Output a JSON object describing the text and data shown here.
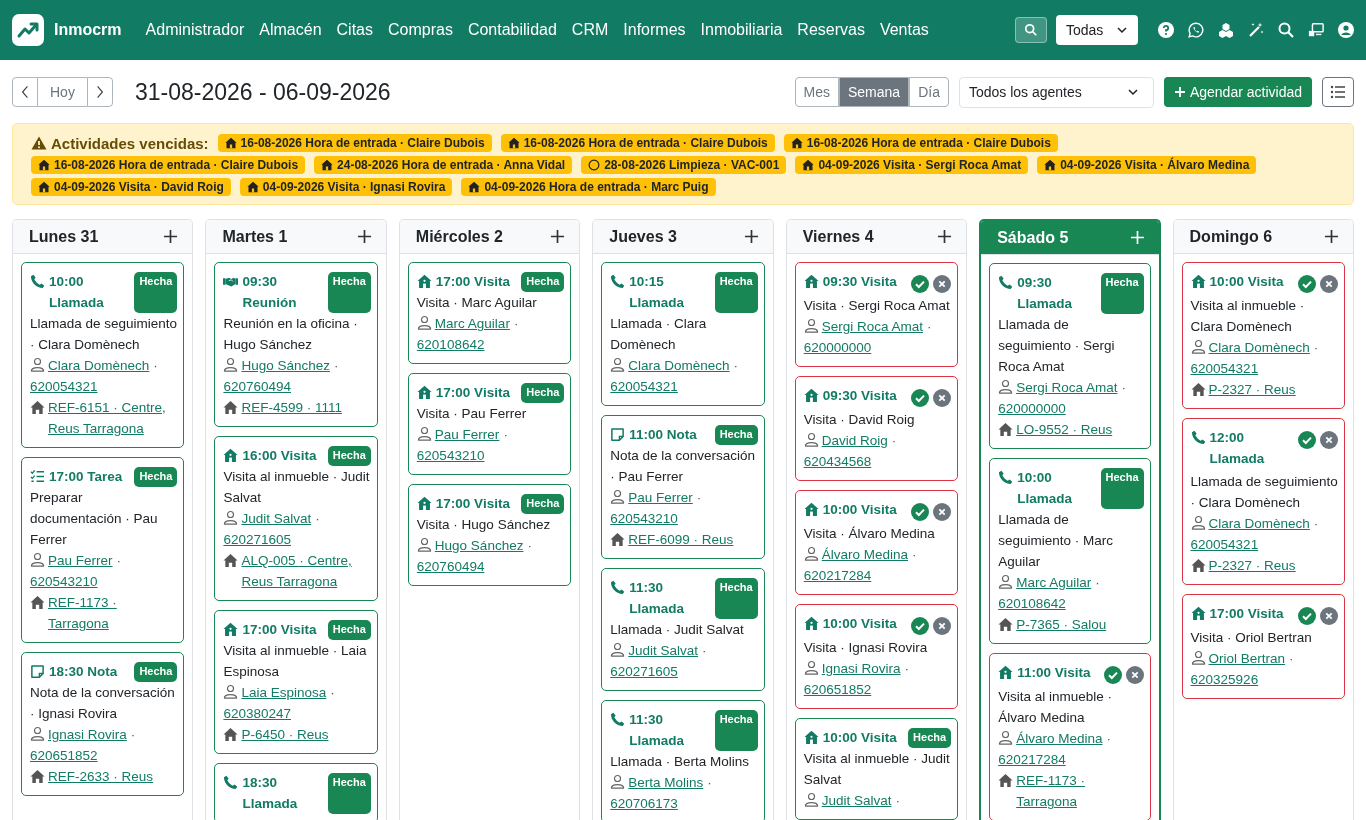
{
  "brand": "Inmocrm",
  "nav": [
    "Administrador",
    "Almacén",
    "Citas",
    "Compras",
    "Contabilidad",
    "CRM",
    "Informes",
    "Inmobiliaria",
    "Reservas",
    "Ventas"
  ],
  "scope_select": {
    "value": "Todas"
  },
  "toolbar": {
    "today": "Hoy",
    "range": "31-08-2026 - 06-09-2026",
    "views": [
      {
        "label": "Mes",
        "selected": false
      },
      {
        "label": "Semana",
        "selected": true
      },
      {
        "label": "Día",
        "selected": false
      }
    ],
    "agent_select": {
      "value": "Todos los agentes"
    },
    "add_button": "Agendar actividad"
  },
  "overdue": {
    "title": "Actividades vencidas:",
    "items": [
      {
        "kind": "visit",
        "text": "16-08-2026 Hora de entrada · Claire Dubois"
      },
      {
        "kind": "visit",
        "text": "16-08-2026 Hora de entrada · Claire Dubois"
      },
      {
        "kind": "visit",
        "text": "16-08-2026 Hora de entrada · Claire Dubois"
      },
      {
        "kind": "visit",
        "text": "16-08-2026 Hora de entrada · Claire Dubois"
      },
      {
        "kind": "visit",
        "text": "24-08-2026 Hora de entrada · Anna Vidal"
      },
      {
        "kind": "other",
        "text": "28-08-2026 Limpieza · VAC-001"
      },
      {
        "kind": "visit",
        "text": "04-09-2026 Visita · Sergi Roca Amat"
      },
      {
        "kind": "visit",
        "text": "04-09-2026 Visita · Álvaro Medina"
      },
      {
        "kind": "visit",
        "text": "04-09-2026 Visita · David Roig"
      },
      {
        "kind": "visit",
        "text": "04-09-2026 Visita · Ignasi Rovira"
      },
      {
        "kind": "visit",
        "text": "04-09-2026 Hora de entrada · Marc Puig"
      }
    ]
  },
  "separator": "·",
  "days": [
    {
      "label": "Lunes 31",
      "selected": false,
      "events": [
        {
          "kind": "call",
          "title": "10:00 Llamada",
          "done": true,
          "badge": "Hecha",
          "description": "Llamada de seguimiento · Clara Domènech",
          "contact": "Clara Domènech",
          "phone": "620054321",
          "property": "REF-6151 · Centre, Reus Tarragona"
        },
        {
          "kind": "task",
          "title": "17:00 Tarea",
          "done": true,
          "badge": "Hecha",
          "description": "Preparar documentación · Pau Ferrer",
          "contact": "Pau Ferrer",
          "phone": "620543210",
          "property": "REF-1173 · Tarragona"
        },
        {
          "kind": "note",
          "title": "18:30 Nota",
          "done": true,
          "badge": "Hecha",
          "description": "Nota de la conversación · Ignasi Rovira",
          "contact": "Ignasi Rovira",
          "phone": "620651852",
          "property": "REF-2633 · Reus"
        }
      ]
    },
    {
      "label": "Martes 1",
      "selected": false,
      "events": [
        {
          "kind": "meeting",
          "title": "09:30 Reunión",
          "done": true,
          "badge": "Hecha",
          "description": "Reunión en la oficina · Hugo Sánchez",
          "contact": "Hugo Sánchez",
          "phone": "620760494",
          "property": "REF-4599 · 1111"
        },
        {
          "kind": "visit",
          "title": "16:00 Visita",
          "done": true,
          "badge": "Hecha",
          "description": "Visita al inmueble · Judit Salvat",
          "contact": "Judit Salvat",
          "phone": "620271605",
          "property": "ALQ-005 · Centre, Reus Tarragona"
        },
        {
          "kind": "visit",
          "title": "17:00 Visita",
          "done": true,
          "badge": "Hecha",
          "description": "Visita al inmueble · Laia Espinosa",
          "contact": "Laia Espinosa",
          "phone": "620380247",
          "property": "P-6450 · Reus"
        },
        {
          "kind": "call",
          "title": "18:30 Llamada",
          "done": true,
          "badge": "Hecha"
        }
      ]
    },
    {
      "label": "Miércoles 2",
      "selected": false,
      "events": [
        {
          "kind": "visit",
          "title": "17:00 Visita",
          "done": true,
          "badge": "Hecha",
          "description": "Visita · Marc Aguilar",
          "contact": "Marc Aguilar",
          "phone": "620108642"
        },
        {
          "kind": "visit",
          "title": "17:00 Visita",
          "done": true,
          "badge": "Hecha",
          "description": "Visita · Pau Ferrer",
          "contact": "Pau Ferrer",
          "phone": "620543210"
        },
        {
          "kind": "visit",
          "title": "17:00 Visita",
          "done": true,
          "badge": "Hecha",
          "description": "Visita · Hugo Sánchez",
          "contact": "Hugo Sánchez",
          "phone": "620760494"
        }
      ]
    },
    {
      "label": "Jueves 3",
      "selected": false,
      "events": [
        {
          "kind": "call",
          "title": "10:15 Llamada",
          "done": true,
          "badge": "Hecha",
          "description": "Llamada · Clara Domènech",
          "contact": "Clara Domènech",
          "phone": "620054321"
        },
        {
          "kind": "note",
          "title": "11:00 Nota",
          "done": true,
          "badge": "Hecha",
          "description": "Nota de la conversación · Pau Ferrer",
          "contact": "Pau Ferrer",
          "phone": "620543210",
          "property": "REF-6099 · Reus"
        },
        {
          "kind": "call",
          "title": "11:30 Llamada",
          "done": true,
          "badge": "Hecha",
          "description": "Llamada · Judit Salvat",
          "contact": "Judit Salvat",
          "phone": "620271605"
        },
        {
          "kind": "call",
          "title": "11:30 Llamada",
          "done": true,
          "badge": "Hecha",
          "description": "Llamada · Berta Molins",
          "contact": "Berta Molins",
          "phone": "620706173"
        }
      ]
    },
    {
      "label": "Viernes 4",
      "selected": false,
      "events": [
        {
          "kind": "visit",
          "title": "09:30 Visita",
          "done": false,
          "description": "Visita · Sergi Roca Amat",
          "contact": "Sergi Roca Amat",
          "phone": "620000000"
        },
        {
          "kind": "visit",
          "title": "09:30 Visita",
          "done": false,
          "description": "Visita · David Roig",
          "contact": "David Roig",
          "phone": "620434568"
        },
        {
          "kind": "visit",
          "title": "10:00 Visita",
          "done": false,
          "description": "Visita · Álvaro Medina",
          "contact": "Álvaro Medina",
          "phone": "620217284"
        },
        {
          "kind": "visit",
          "title": "10:00 Visita",
          "done": false,
          "description": "Visita · Ignasi Rovira",
          "contact": "Ignasi Rovira",
          "phone": "620651852"
        },
        {
          "kind": "visit",
          "title": "10:00 Visita",
          "done": true,
          "badge": "Hecha",
          "description": "Visita al inmueble · Judit Salvat",
          "contact": "Judit Salvat"
        }
      ]
    },
    {
      "label": "Sábado 5",
      "selected": true,
      "events": [
        {
          "kind": "call",
          "title": "09:30 Llamada",
          "done": true,
          "badge": "Hecha",
          "description": "Llamada de seguimiento · Sergi Roca Amat",
          "contact": "Sergi Roca Amat",
          "phone": "620000000",
          "property": "LO-9552 · Reus"
        },
        {
          "kind": "call",
          "title": "10:00 Llamada",
          "done": true,
          "badge": "Hecha",
          "description": "Llamada de seguimiento · Marc Aguilar",
          "contact": "Marc Aguilar",
          "phone": "620108642",
          "property": "P-7365 · Salou"
        },
        {
          "kind": "visit",
          "title": "11:00 Visita",
          "done": false,
          "description": "Visita al inmueble · Álvaro Medina",
          "contact": "Álvaro Medina",
          "phone": "620217284",
          "property": "REF-1173 · Tarragona"
        }
      ]
    },
    {
      "label": "Domingo 6",
      "selected": false,
      "events": [
        {
          "kind": "visit",
          "title": "10:00 Visita",
          "done": false,
          "description": "Visita al inmueble · Clara Domènech",
          "contact": "Clara Domènech",
          "phone": "620054321",
          "property": "P-2327 · Reus"
        },
        {
          "kind": "call",
          "title": "12:00 Llamada",
          "done": false,
          "description": "Llamada de seguimiento · Clara Domènech",
          "contact": "Clara Domènech",
          "phone": "620054321",
          "property": "P-2327 · Reus"
        },
        {
          "kind": "visit",
          "title": "17:00 Visita",
          "done": false,
          "description": "Visita · Oriol Bertran",
          "contact": "Oriol Bertran",
          "phone": "620325926"
        }
      ]
    }
  ]
}
